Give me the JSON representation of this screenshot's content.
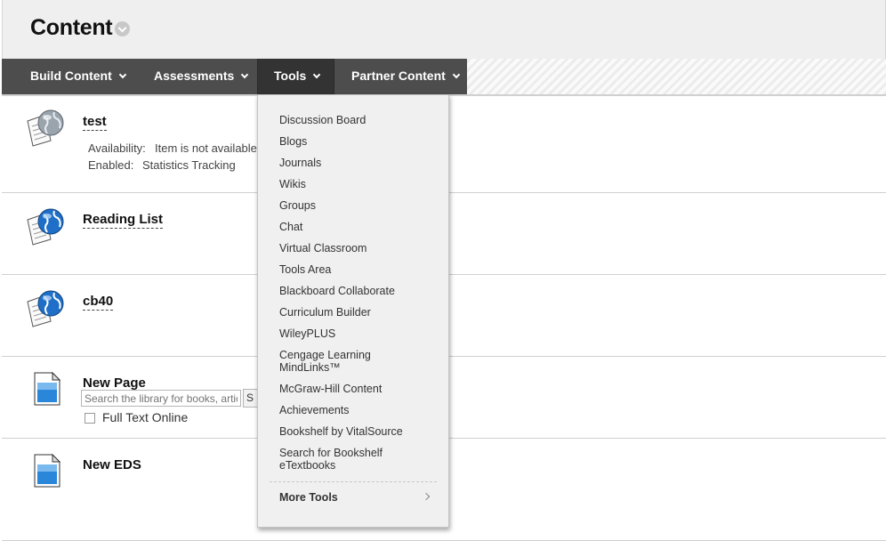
{
  "header": {
    "title": "Content"
  },
  "menubar": {
    "items": [
      {
        "label": "Build Content"
      },
      {
        "label": "Assessments"
      },
      {
        "label": "Tools"
      },
      {
        "label": "Partner Content"
      }
    ]
  },
  "content": {
    "items": [
      {
        "title": "test",
        "availability_label": "Availability:",
        "availability_value": "Item is not available",
        "enabled_label": "Enabled:",
        "enabled_value": "Statistics Tracking"
      },
      {
        "title": "Reading List"
      },
      {
        "title": "cb40"
      },
      {
        "title": "New Page"
      },
      {
        "title": "New EDS",
        "search_placeholder": "Search the library for books, artic",
        "search_button": "S",
        "checkbox_label": "Full Text Online"
      }
    ]
  },
  "tools_menu": {
    "items": [
      "Discussion Board",
      "Blogs",
      "Journals",
      "Wikis",
      "Groups",
      "Chat",
      "Virtual Classroom",
      "Tools Area",
      "Blackboard Collaborate",
      "Curriculum Builder",
      "WileyPLUS",
      "Cengage Learning",
      "MindLinks™",
      "McGraw-Hill Content",
      "Achievements",
      "Bookshelf by VitalSource",
      "Search for Bookshelf",
      "eTextbooks"
    ],
    "more": "More Tools"
  }
}
